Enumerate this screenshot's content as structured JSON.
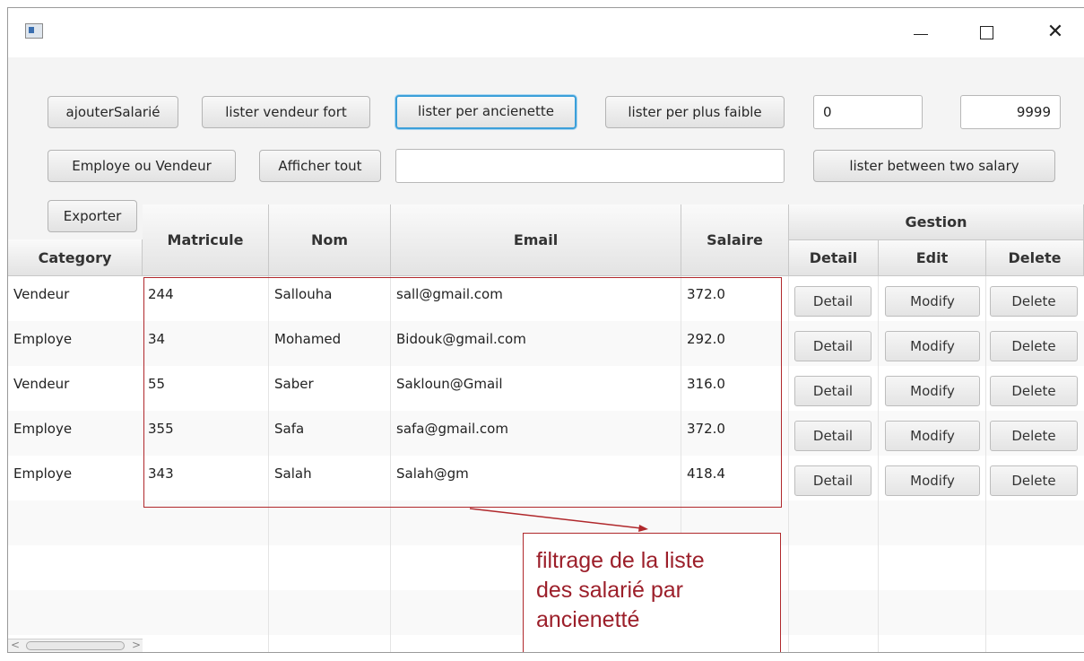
{
  "toolbar": {
    "ajouter": "ajouterSalarié",
    "lister_vendeur_fort": "lister vendeur fort",
    "lister_anciennete": "lister per ancienette",
    "lister_plus_faible": "lister per plus faible",
    "min_salary": "0",
    "max_salary": "9999",
    "employe_ou_vendeur": "Employe ou Vendeur",
    "afficher_tout": "Afficher tout",
    "search_value": "",
    "lister_between": "lister between two salary",
    "exporter": "Exporter"
  },
  "table": {
    "category_header": "Category",
    "headers": {
      "matricule": "Matricule",
      "nom": "Nom",
      "email": "Email",
      "salaire": "Salaire",
      "gestion": "Gestion",
      "detail": "Detail",
      "edit": "Edit",
      "delete": "Delete"
    },
    "rows": [
      {
        "category": "Vendeur",
        "matricule": "244",
        "nom": "Sallouha",
        "email": "sall@gmail.com",
        "salaire": "372.0",
        "detail": "Detail",
        "modify": "Modify",
        "delete": "Delete"
      },
      {
        "category": "Employe",
        "matricule": "34",
        "nom": "Mohamed",
        "email": "Bidouk@gmail.com",
        "salaire": "292.0",
        "detail": "Detail",
        "modify": "Modify",
        "delete": "Delete"
      },
      {
        "category": "Vendeur",
        "matricule": "55",
        "nom": "Saber",
        "email": "Sakloun@Gmail",
        "salaire": "316.0",
        "detail": "Detail",
        "modify": "Modify",
        "delete": "Delete"
      },
      {
        "category": "Employe",
        "matricule": "355",
        "nom": "Safa",
        "email": "safa@gmail.com",
        "salaire": "372.0",
        "detail": "Detail",
        "modify": "Modify",
        "delete": "Delete"
      },
      {
        "category": "Employe",
        "matricule": "343",
        "nom": "Salah",
        "email": "Salah@gm",
        "salaire": "418.4",
        "detail": "Detail",
        "modify": "Modify",
        "delete": "Delete"
      }
    ]
  },
  "annotation": {
    "line1": "filtrage de la liste",
    "line2": "des salarié par",
    "line3": "ancienetté",
    "color": "#b0282c"
  }
}
